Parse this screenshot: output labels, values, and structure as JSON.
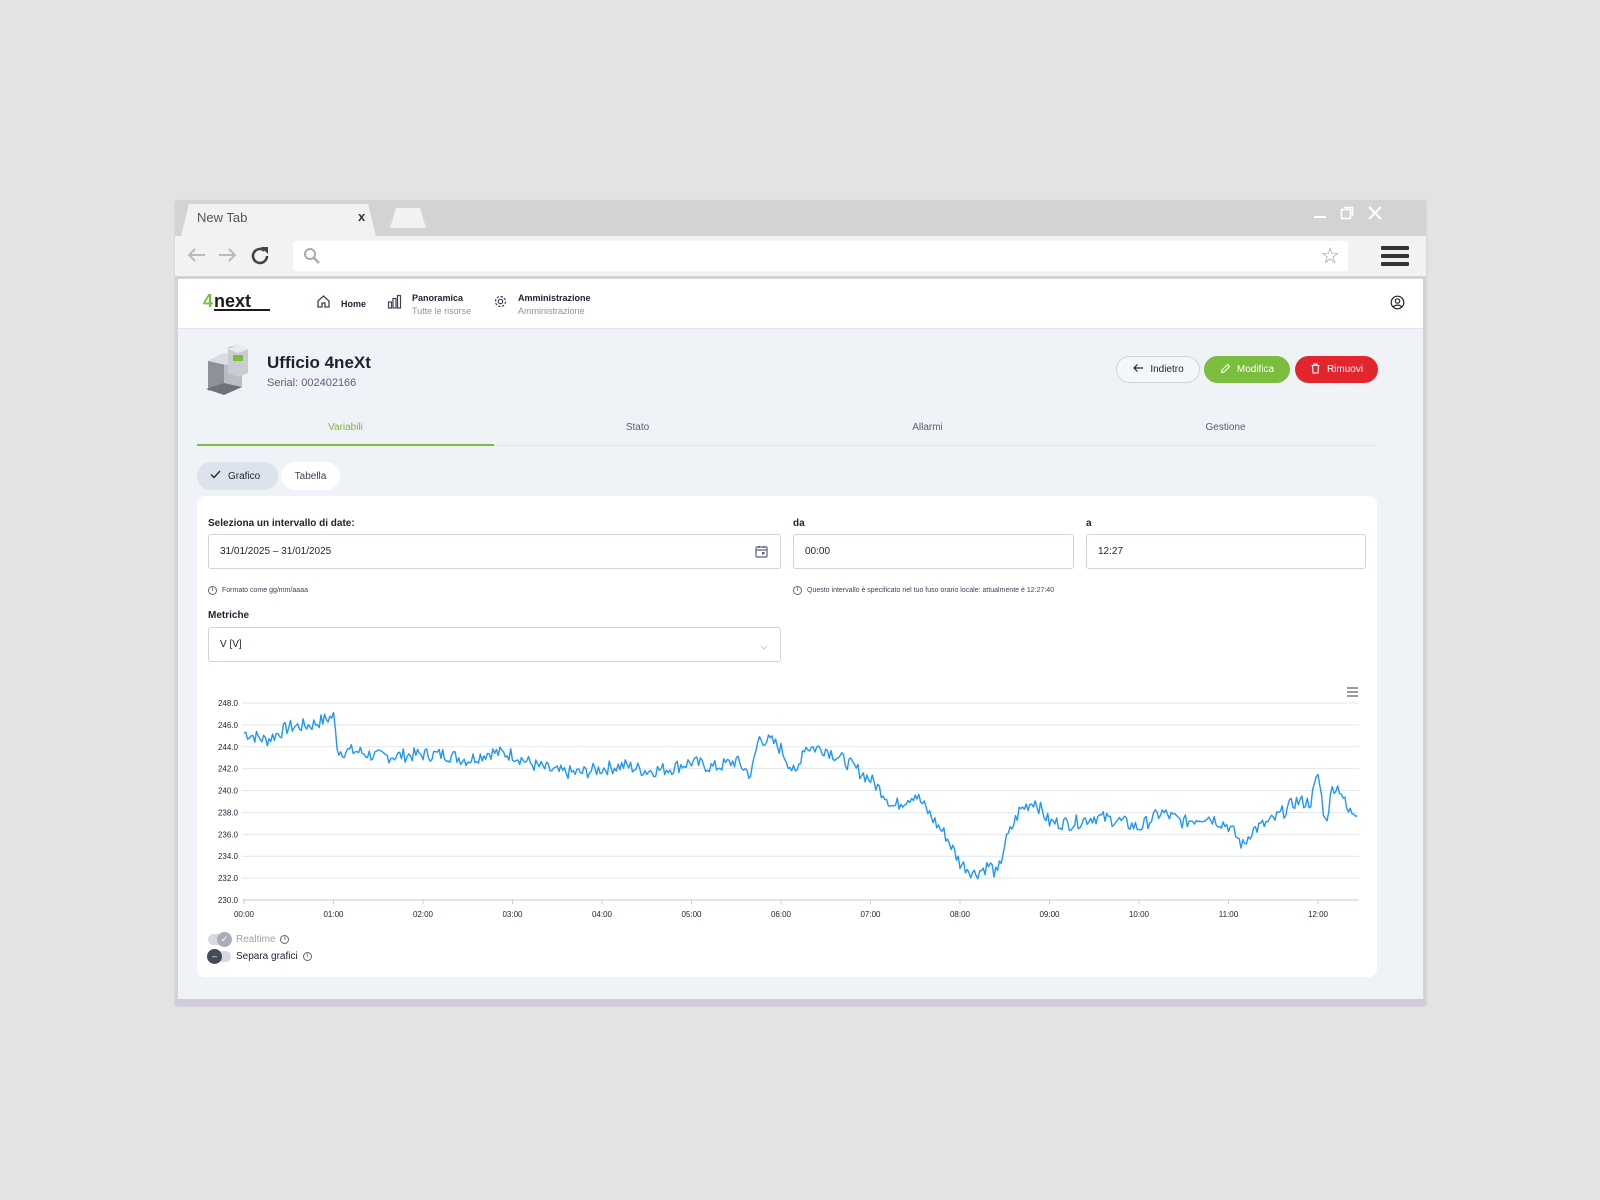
{
  "browser": {
    "tab_title": "New Tab",
    "tab_close": "x",
    "url_value": ""
  },
  "nav": {
    "home": "Home",
    "panoramica": "Panoramica",
    "panoramica_sub": "Tutte le risorse",
    "amministrazione": "Amministrazione",
    "amministrazione_sub": "Amministrazione"
  },
  "device": {
    "title": "Ufficio 4neXt",
    "serial": "Serial: 002402166"
  },
  "actions": {
    "back": "Indietro",
    "edit": "Modifica",
    "remove": "Rimuovi"
  },
  "tabs": [
    "Variabili",
    "Stato",
    "Allarmi",
    "Gestione"
  ],
  "view_toggle": {
    "chart": "Grafico",
    "table": "Tabella"
  },
  "filters": {
    "date_label": "Seleziona un intervallo di date:",
    "date_value": "31/01/2025 – 31/01/2025",
    "date_hint": "Formato come gg/mm/aaaa",
    "from_label": "da",
    "from_value": "00:00",
    "to_label": "a",
    "to_value": "12:27",
    "time_hint": "Questo intervallo è specificato nel tuo fuso orario locale: attualmente è 12:27:40",
    "metrics_label": "Metriche",
    "metrics_value": "V [V]"
  },
  "switches": {
    "realtime": "Realtime",
    "split": "Separa grafici"
  },
  "colors": {
    "accent_green": "#7bbd3c",
    "danger_red": "#e3262d",
    "series_blue": "#2196f3"
  },
  "chart_data": {
    "type": "line",
    "title": "",
    "xlabel": "",
    "ylabel": "",
    "ylim": [
      230,
      248
    ],
    "yticks": [
      "230.0",
      "232.0",
      "234.0",
      "236.0",
      "238.0",
      "240.0",
      "242.0",
      "244.0",
      "246.0",
      "248.0"
    ],
    "xticks": [
      "00:00",
      "01:00",
      "02:00",
      "03:00",
      "04:00",
      "05:00",
      "06:00",
      "07:00",
      "08:00",
      "09:00",
      "10:00",
      "11:00",
      "12:00"
    ],
    "grid": true,
    "legend": "none",
    "series": [
      {
        "x": [
          "00:00",
          "00:15",
          "00:30",
          "00:45",
          "01:00",
          "01:03",
          "01:15",
          "01:30",
          "01:45",
          "02:00",
          "02:15",
          "02:30",
          "02:45",
          "03:00",
          "03:15",
          "03:30",
          "03:45",
          "04:00",
          "04:15",
          "04:30",
          "04:45",
          "05:00",
          "05:15",
          "05:30",
          "05:40",
          "05:45",
          "05:55",
          "06:00",
          "06:10",
          "06:15",
          "06:30",
          "06:45",
          "06:55",
          "07:00",
          "07:10",
          "07:15",
          "07:30",
          "07:45",
          "07:50",
          "08:00",
          "08:10",
          "08:20",
          "08:25",
          "08:30",
          "08:40",
          "08:50",
          "09:00",
          "09:15",
          "09:30",
          "09:45",
          "10:00",
          "10:15",
          "10:30",
          "10:45",
          "11:00",
          "11:10",
          "11:15",
          "11:30",
          "11:45",
          "11:55",
          "12:00",
          "12:05",
          "12:10",
          "12:15",
          "12:20",
          "12:27"
        ],
        "values": [
          245.3,
          244.6,
          245.8,
          246.0,
          246.8,
          243.6,
          243.6,
          243.1,
          243.2,
          243.3,
          243.3,
          242.8,
          243.5,
          243.3,
          242.3,
          241.7,
          241.6,
          242.0,
          242.3,
          241.8,
          242.0,
          242.6,
          242.1,
          242.7,
          241.4,
          244.8,
          244.4,
          243.8,
          241.3,
          244.0,
          243.8,
          242.5,
          241.5,
          241.0,
          239.6,
          238.5,
          239.7,
          236.8,
          236.0,
          233.4,
          232.4,
          233.2,
          232.2,
          235.1,
          238.2,
          239.1,
          237.1,
          237.0,
          237.6,
          237.3,
          236.6,
          238.0,
          237.1,
          237.7,
          236.8,
          234.9,
          236.3,
          237.3,
          239.0,
          238.9,
          241.5,
          237.0,
          240.4,
          240.2,
          238.0,
          238.2
        ]
      }
    ]
  }
}
